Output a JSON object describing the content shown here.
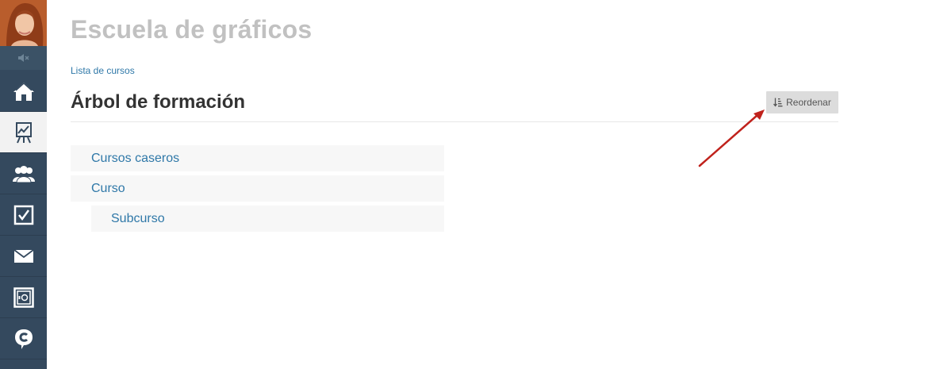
{
  "sidebar": {
    "avatar_icon": "user-avatar",
    "items": [
      {
        "icon": "mute-icon",
        "active": false
      },
      {
        "icon": "home-icon",
        "active": false
      },
      {
        "icon": "chart-board-icon",
        "active": true
      },
      {
        "icon": "users-icon",
        "active": false
      },
      {
        "icon": "checkbox-icon",
        "active": false
      },
      {
        "icon": "mail-icon",
        "active": false
      },
      {
        "icon": "safe-icon",
        "active": false
      },
      {
        "icon": "chat-c-icon",
        "active": false
      }
    ]
  },
  "header": {
    "school_title": "Escuela de gráficos",
    "breadcrumb": "Lista de cursos"
  },
  "main": {
    "page_title": "Árbol de formación",
    "reorder_button": {
      "label": "Reordenar",
      "icon": "sort-icon"
    },
    "tree": [
      {
        "label": "Cursos caseros",
        "level": 0
      },
      {
        "label": "Curso",
        "level": 0
      },
      {
        "label": "Subcurso",
        "level": 1
      }
    ]
  },
  "colors": {
    "sidebar_bg": "#34495e",
    "link": "#2f78a8",
    "annotation_arrow": "#c0221c"
  }
}
